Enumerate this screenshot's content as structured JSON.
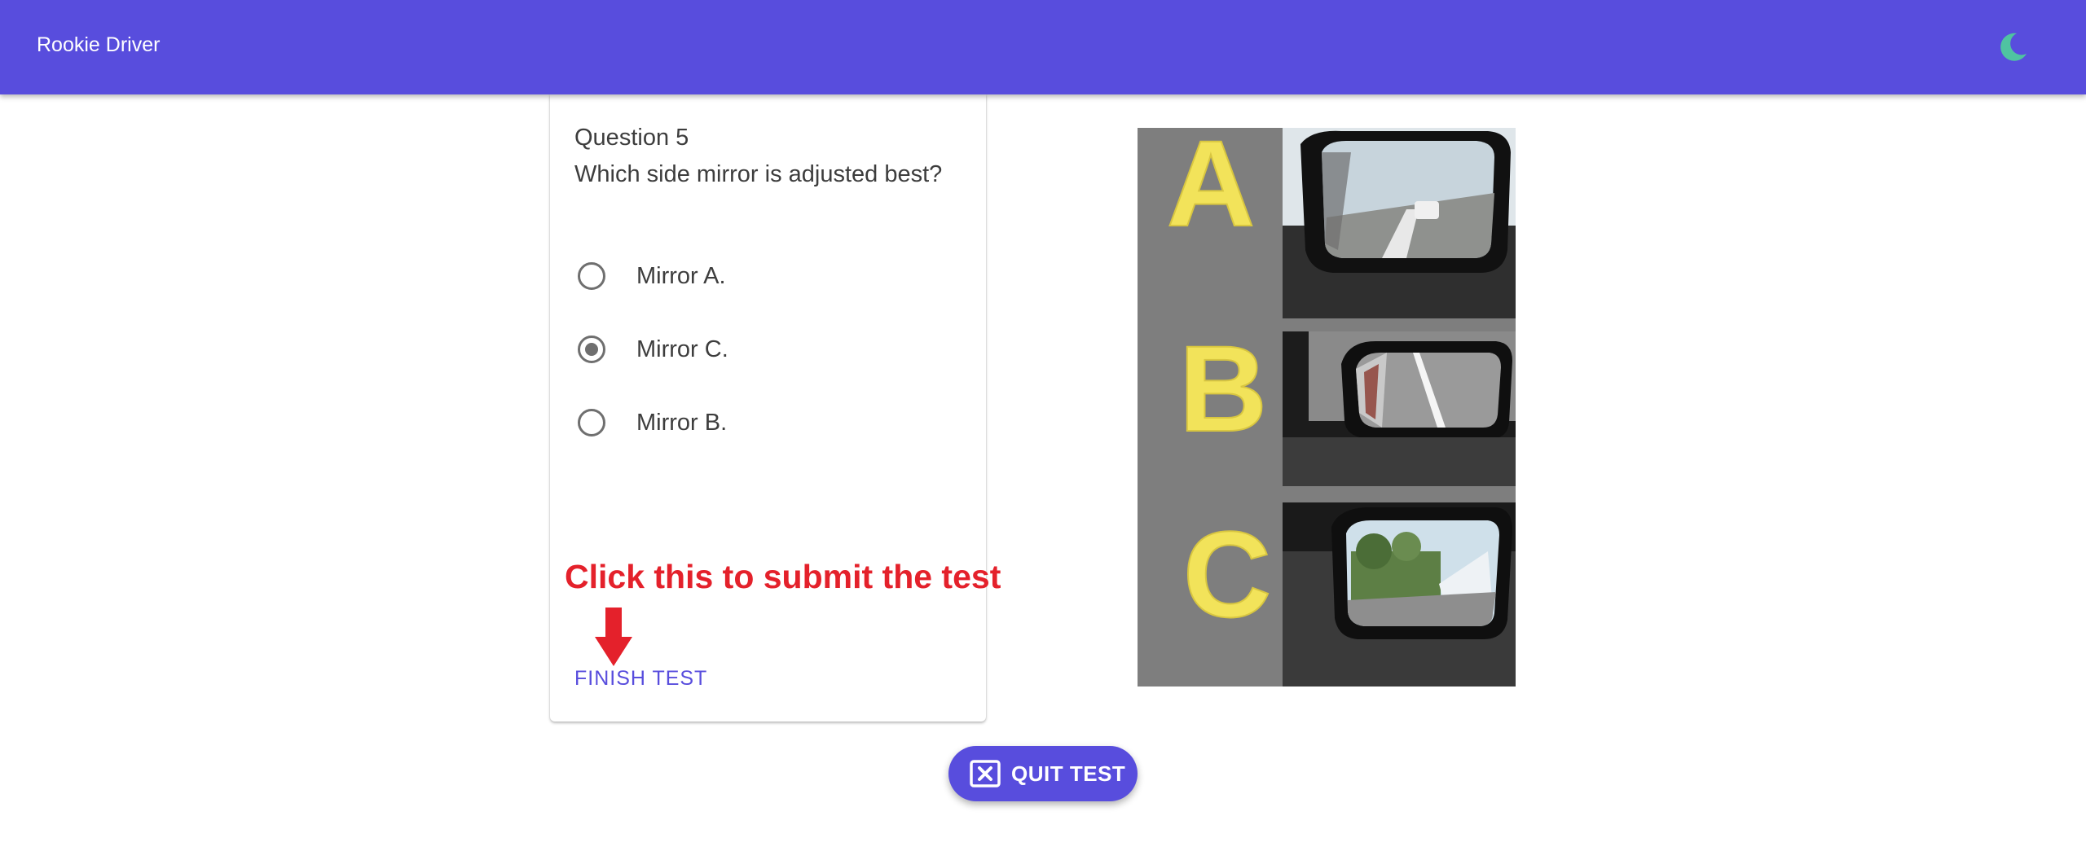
{
  "app": {
    "title": "Rookie Driver",
    "theme_icon": "moon-icon"
  },
  "question": {
    "number_label": "Question 5",
    "text": "Which side mirror is adjusted best?",
    "options": [
      {
        "label": "Mirror A.",
        "selected": false
      },
      {
        "label": "Mirror C.",
        "selected": true
      },
      {
        "label": "Mirror B.",
        "selected": false
      }
    ]
  },
  "actions": {
    "finish_label": "FINISH TEST",
    "quit_label": "QUIT TEST",
    "quit_icon": "close-box-icon"
  },
  "annotation": {
    "text": "Click this to submit the test",
    "arrow_icon": "down-arrow-icon"
  },
  "figure": {
    "panel_letters": [
      "A",
      "B",
      "C"
    ]
  },
  "colors": {
    "primary": "#584ddd",
    "annotation": "#e4212b",
    "moon": "#4fc3a1",
    "letter": "#f2e35a"
  }
}
